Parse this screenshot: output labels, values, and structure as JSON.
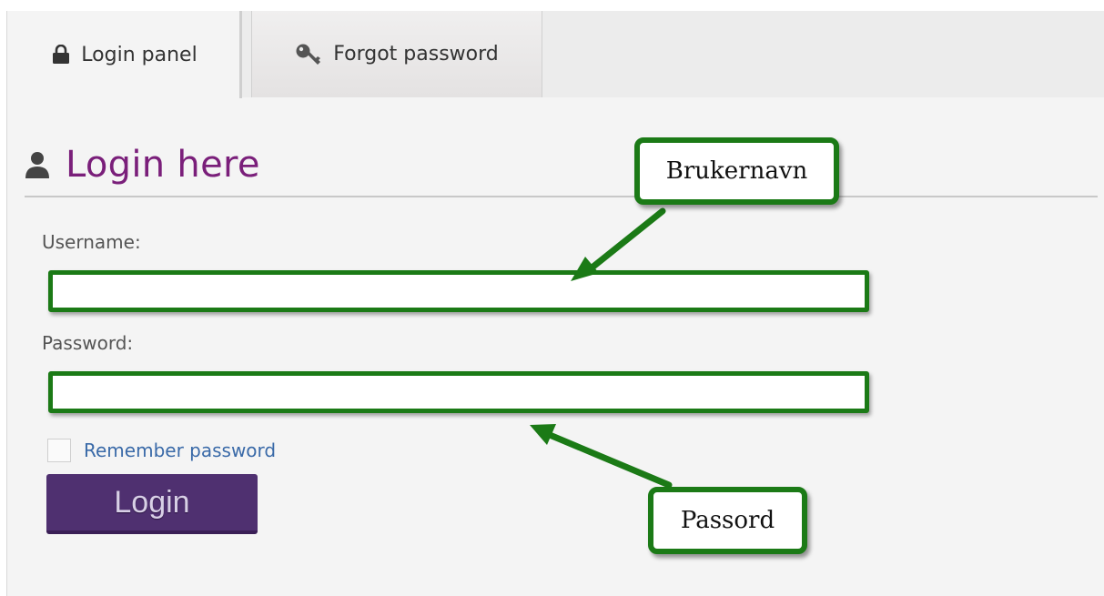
{
  "tabs": {
    "login_label": "Login panel",
    "forgot_label": "Forgot password"
  },
  "form": {
    "heading": "Login here",
    "username_label": "Username:",
    "username_value": "",
    "password_label": "Password:",
    "password_value": "",
    "remember_label": "Remember password",
    "remember_checked": false,
    "submit_label": "Login"
  },
  "annotations": {
    "username_callout": "Brukernavn",
    "password_callout": "Passord"
  },
  "icons": {
    "login_tab": "lock-icon",
    "forgot_tab": "key-icon",
    "heading": "user-icon"
  },
  "colors": {
    "heading": "#7a1f7a",
    "button": "#4f3070",
    "link": "#3a6aa8",
    "annotation_green": "#1b7a16"
  }
}
